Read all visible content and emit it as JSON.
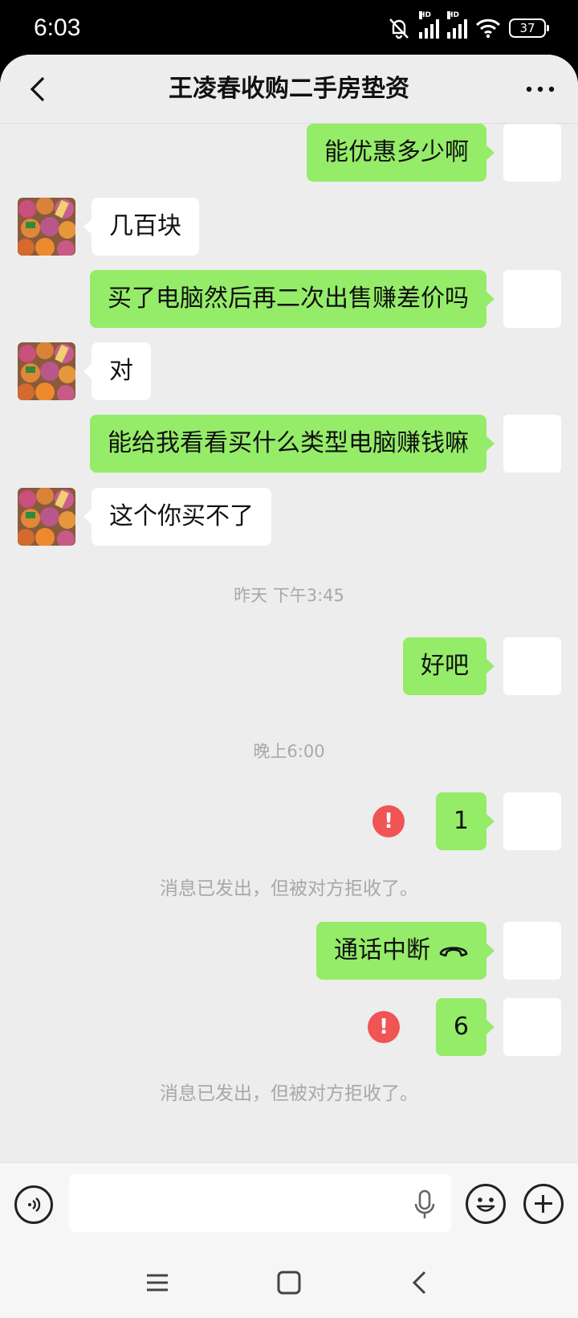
{
  "status_bar": {
    "time": "6:03",
    "signal_label_1": "HD",
    "signal_label_2": "HD",
    "battery": "37"
  },
  "header": {
    "title": "王凌春收购二手房垫资",
    "back_icon": "chevron-left-icon",
    "more_icon": "more-dots-icon"
  },
  "messages": [
    {
      "side": "self",
      "text": "能优惠多少啊"
    },
    {
      "side": "other",
      "text": "几百块"
    },
    {
      "side": "self",
      "text": "买了电脑然后再二次出售赚差价吗"
    },
    {
      "side": "other",
      "text": "对"
    },
    {
      "side": "self",
      "text": "能给我看看买什么类型电脑赚钱嘛"
    },
    {
      "side": "other",
      "text": "这个你买不了"
    },
    {
      "type": "time",
      "text": "昨天 下午3:45"
    },
    {
      "side": "self",
      "text": "好吧"
    },
    {
      "type": "time",
      "text": "晚上6:00"
    },
    {
      "side": "self",
      "text": "1",
      "error": true
    },
    {
      "type": "system",
      "text": "消息已发出，但被对方拒收了。"
    },
    {
      "side": "self",
      "text": "通话中断",
      "call_icon": "phone-hangup-icon"
    },
    {
      "side": "self",
      "text": "6",
      "error": true
    },
    {
      "type": "system",
      "text": "消息已发出，但被对方拒收了。"
    }
  ],
  "error_mark": "!",
  "input_bar": {
    "voice_icon": "voice-icon",
    "input_value": "",
    "mic_icon": "microphone-icon",
    "emoji_icon": "emoji-icon",
    "plus_icon": "plus-icon"
  },
  "colors": {
    "self_bubble": "#95ec69",
    "other_bubble": "#ffffff",
    "background": "#ededed",
    "error": "#f05454"
  },
  "nav_bar": {
    "menu_icon": "menu-icon",
    "home_icon": "home-square-icon",
    "back_icon": "back-triangle-icon"
  }
}
